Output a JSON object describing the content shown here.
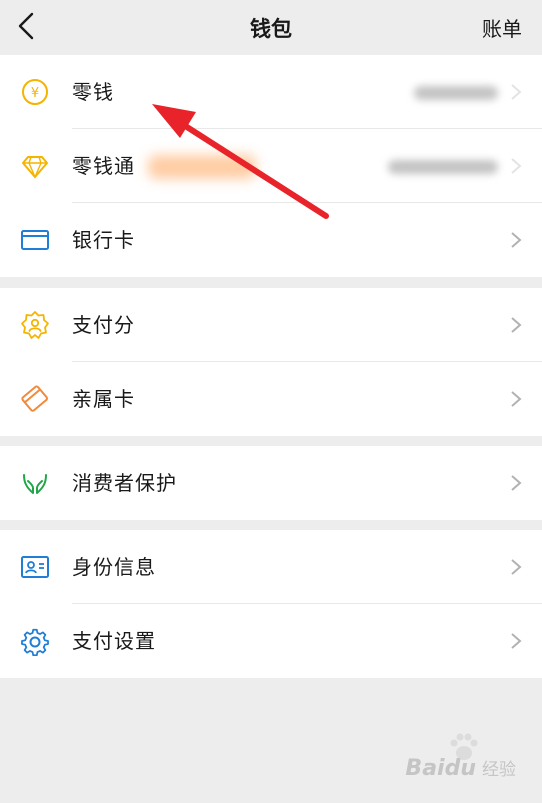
{
  "header": {
    "title": "钱包",
    "bill_label": "账单"
  },
  "groups": [
    {
      "items": [
        {
          "label": "零钱",
          "icon": "yen-coin-icon",
          "amount_hidden": true
        },
        {
          "label": "零钱通",
          "icon": "diamond-icon",
          "amount_hidden": true,
          "tag_hidden": true
        },
        {
          "label": "银行卡",
          "icon": "bank-card-icon"
        }
      ]
    },
    {
      "items": [
        {
          "label": "支付分",
          "icon": "payscore-badge-icon"
        },
        {
          "label": "亲属卡",
          "icon": "family-card-icon"
        }
      ]
    },
    {
      "items": [
        {
          "label": "消费者保护",
          "icon": "protection-hands-icon"
        }
      ]
    },
    {
      "items": [
        {
          "label": "身份信息",
          "icon": "id-card-icon"
        },
        {
          "label": "支付设置",
          "icon": "gear-icon"
        }
      ]
    }
  ],
  "watermark": {
    "brand": "Bai",
    "brand_tail": "du",
    "sub": "经验"
  },
  "colors": {
    "background": "#ededed",
    "yellow": "#f4b400",
    "blue": "#1f7ed6",
    "orange": "#f08a3c",
    "green": "#22a548",
    "arrow_red": "#e8242a"
  }
}
